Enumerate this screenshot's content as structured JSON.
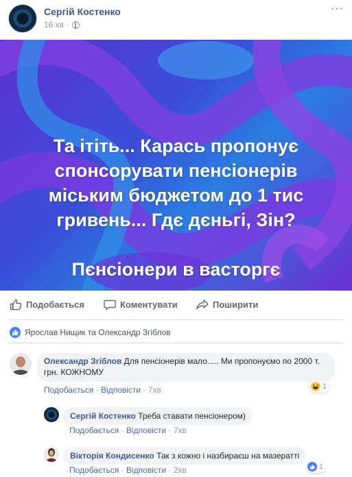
{
  "post": {
    "author": "Сергій Костенко",
    "time": "16 хв",
    "more": "···",
    "banner_lines": [
      "Та ітіть... Карась пропонує",
      "спонсорувати пенсіонерів",
      "міським бюджетом до 1 тис",
      "гривень... Гдє дєньгі, Зін?",
      "Пєнсіонери в васторгє"
    ]
  },
  "actions": {
    "like": "Подобається",
    "comment": "Коментувати",
    "share": "Поширити"
  },
  "reactions": {
    "text": "Ярослав Нищик та Олександр Згіблов"
  },
  "comments": [
    {
      "author": "Олександр Згіблов",
      "text": "Для пенсіонерів мало..... Ми пропонуємо по 2000 т. грн. КОЖНОМУ",
      "like": "Подобається",
      "reply": "Відповісти",
      "sep": "·",
      "time": "7хв",
      "reaction_count": "1"
    },
    {
      "author": "Сергій Костенко",
      "text": "Треба ставати пенсіонером)",
      "like": "Подобається",
      "reply": "Відповісти",
      "sep": "·",
      "time": "7хв"
    },
    {
      "author": "Вікторія Кондисенко",
      "text": "Так з кожно і назбираєш на мазератті",
      "like": "Подобається",
      "reply": "Відповісти",
      "sep": "·",
      "time": "2хв",
      "reaction_count": "1"
    }
  ],
  "colors": {
    "link": "#385898",
    "action_link": "#4267b2",
    "muted": "#90949c",
    "bubble": "#f2f3f5",
    "like_blue": "#4080ff"
  }
}
